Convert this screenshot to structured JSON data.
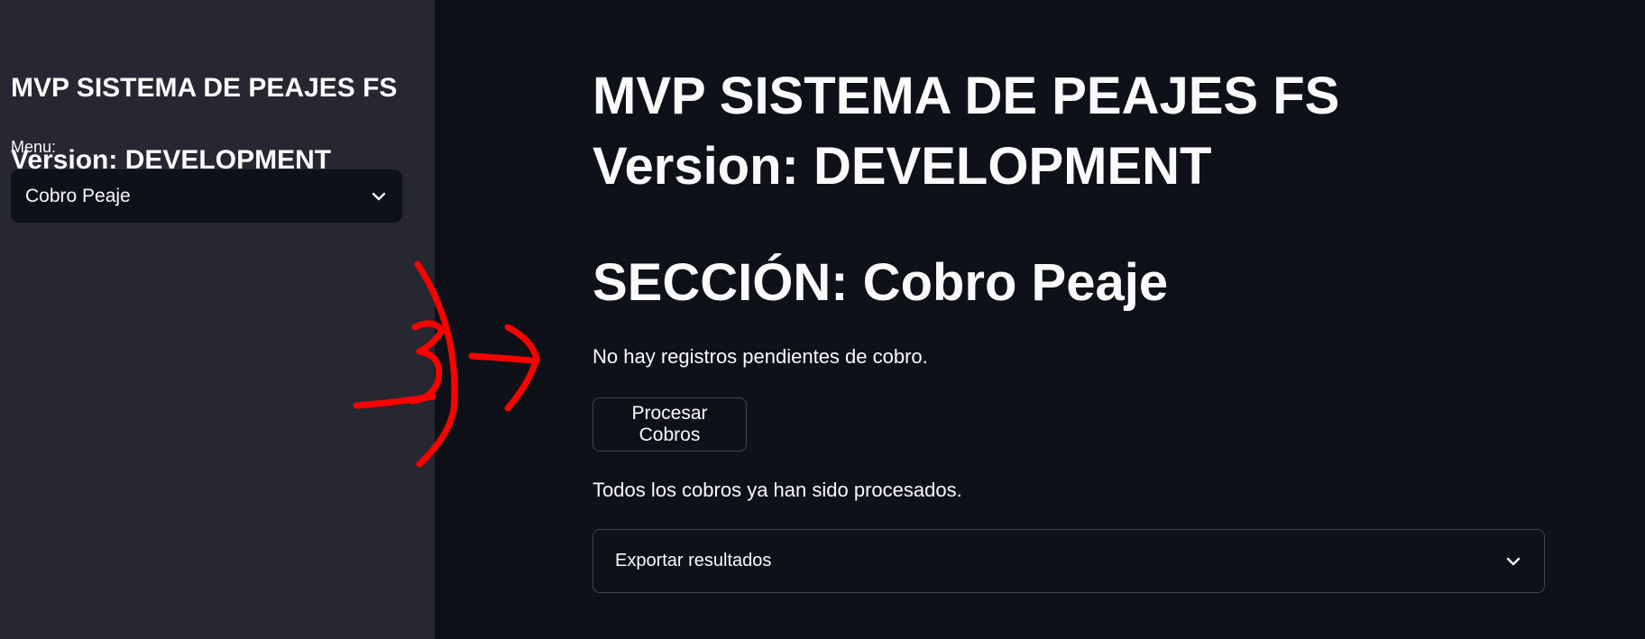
{
  "sidebar": {
    "title_line1": "MVP SISTEMA DE PEAJES FS",
    "title_line2": "Version: DEVELOPMENT",
    "menu_label": "Menu:",
    "menu_selected": "Cobro Peaje",
    "menu_icon": "chevron-down-icon"
  },
  "main": {
    "title": "MVP SISTEMA DE PEAJES FS Version: DEVELOPMENT",
    "section_title": "SECCIÓN: Cobro Peaje",
    "msg_pending": "No hay registros pendientes de cobro.",
    "process_button": "Procesar Cobros",
    "msg_done": "Todos los cobros ya han sido procesados.",
    "expander_label": "Exportar resultados",
    "expander_icon": "chevron-down-icon"
  },
  "annotation": {
    "text": "3",
    "color": "#ff0000"
  },
  "colors": {
    "background": "#0e1117",
    "sidebar_background": "#262730",
    "text": "#fafafa"
  }
}
